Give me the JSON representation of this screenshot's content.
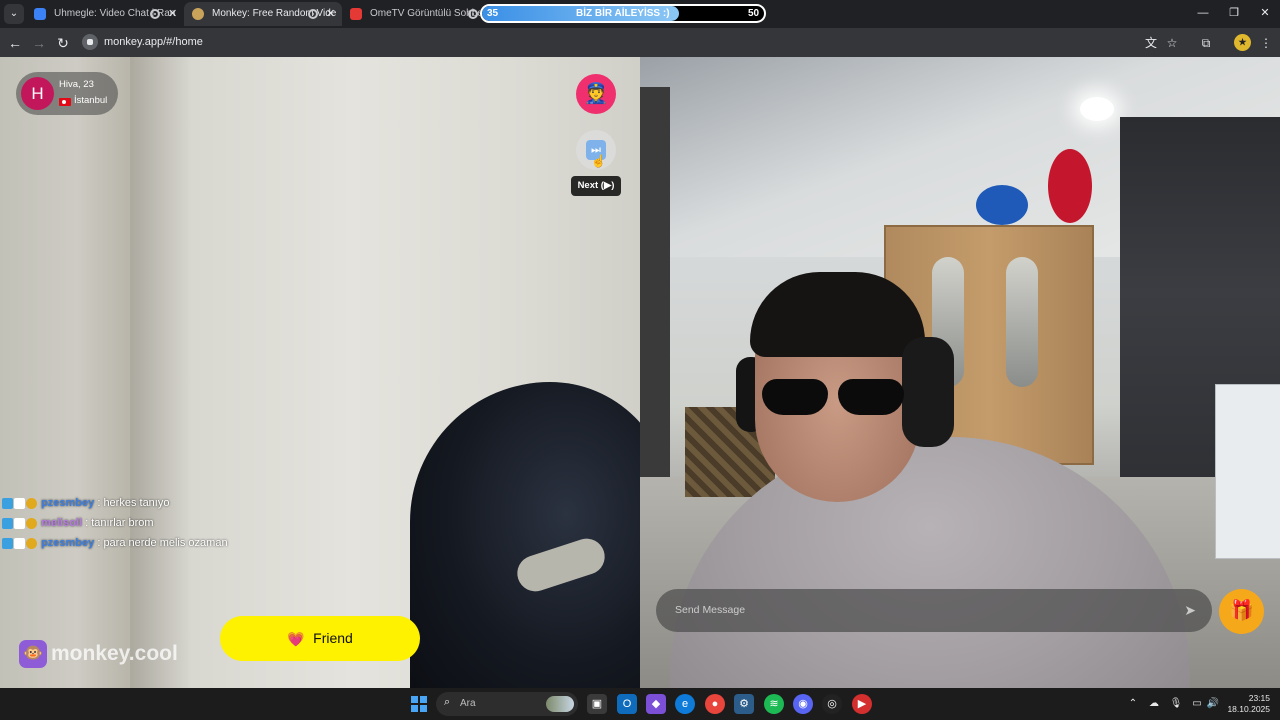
{
  "browser": {
    "tabs": [
      {
        "title": "Uhmegle: Video Chat | Ran",
        "favicon_color": "#3b82f6"
      },
      {
        "title": "Monkey: Free Random Vide",
        "favicon_color": "#caa35b",
        "active": true
      },
      {
        "title": "OmeTV Görüntülü Sohbet",
        "favicon_color": "#e53935"
      }
    ],
    "banner": {
      "left_value": "35",
      "text": "BİZ BİR AİLEYİSS :)",
      "right_value": "50",
      "progress_fraction": 0.7
    },
    "url": "monkey.app/#/home"
  },
  "remote_user": {
    "initial": "H",
    "name_age": "Hiva, 23",
    "city": "İstanbul",
    "avatar_color": "#c2185b"
  },
  "controls": {
    "report_icon": "police-officer-icon",
    "next_icon": "next-track-icon",
    "next_tooltip": "Next (▶)"
  },
  "chat": [
    {
      "user": "pzesmbey",
      "message": ": herkes tanıyo",
      "user_color": "#3d7fe0"
    },
    {
      "user": "melisoll",
      "message": ": tanırlar brom",
      "user_color": "#b57ae0"
    },
    {
      "user": "pzesmbey",
      "message": ": para nerde melis ozaman",
      "user_color": "#3d7fe0"
    }
  ],
  "friend_button": {
    "label": "Friend",
    "icon": "heart-icon"
  },
  "brand": {
    "text": "monkey.cool",
    "icon": "monkey-icon"
  },
  "message_input": {
    "placeholder": "Send Message",
    "send_icon": "send-icon"
  },
  "gift_button": {
    "icon": "gift-icon"
  },
  "taskbar": {
    "search_placeholder": "Ara",
    "time": "23:15",
    "date": "18.10.2025"
  }
}
